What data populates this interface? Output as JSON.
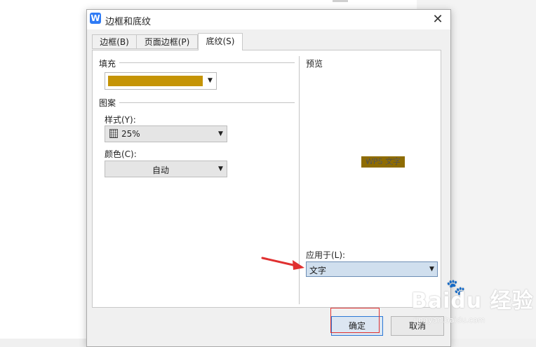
{
  "dialog": {
    "title": "边框和底纹",
    "close_glyph": "✕",
    "app_icon_letter": "W"
  },
  "tabs": [
    {
      "label": "边框(B)",
      "active": false
    },
    {
      "label": "页面边框(P)",
      "active": false
    },
    {
      "label": "底纹(S)",
      "active": true
    }
  ],
  "fill": {
    "label": "填充",
    "color": "#c59405",
    "caret": "▼"
  },
  "pattern": {
    "label": "图案",
    "style_label": "样式(Y):",
    "style_value": "25%",
    "color_label": "颜色(C):",
    "color_value": "自动"
  },
  "preview": {
    "label": "预览",
    "sample_text": "WPS 文字"
  },
  "apply": {
    "label": "应用于(L):",
    "value": "文字"
  },
  "buttons": {
    "ok": "确定",
    "cancel": "取消"
  },
  "watermark": {
    "brand": "Baidu 经验",
    "url": "jingyan.baidu.com"
  },
  "colors": {
    "annotation_red": "#e03030",
    "primary_border": "#2b78d6"
  }
}
